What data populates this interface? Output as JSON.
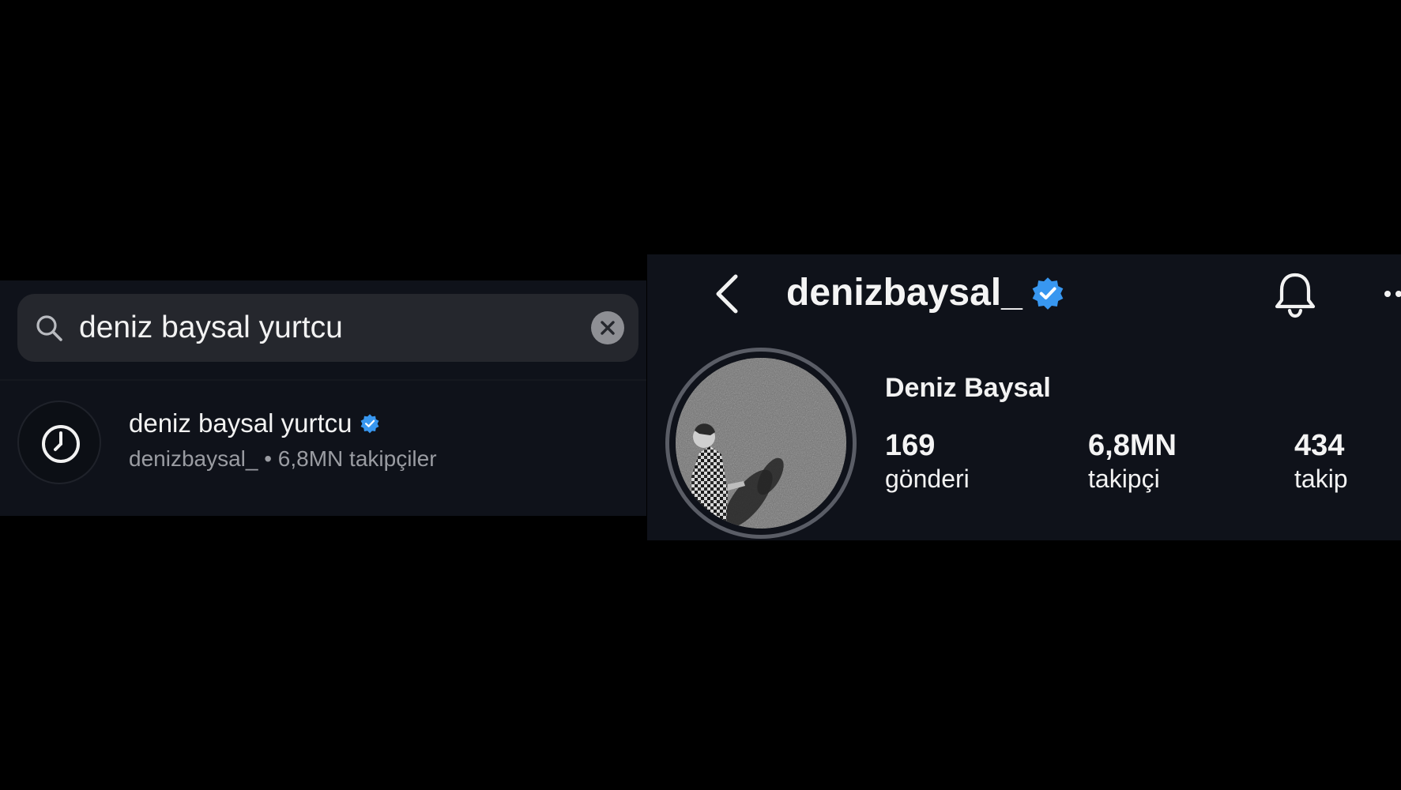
{
  "search_screen": {
    "search_query": "deniz baysal yurtcu",
    "recent_result": {
      "name": "deniz baysal yurtcu",
      "subtitle": "denizbaysal_ • 6,8MN takipçiler"
    }
  },
  "profile_screen": {
    "username": "denizbaysal_",
    "display_name": "Deniz Baysal",
    "stats": {
      "posts_value": "169",
      "posts_label": "gönderi",
      "followers_value": "6,8MN",
      "followers_label": "takipçi",
      "following_value": "434",
      "following_label": "takip"
    }
  },
  "icons": {
    "search": "search-icon",
    "clear": "clear-icon",
    "history": "clock-icon",
    "verified": "verified-badge-icon",
    "back": "chevron-left-icon",
    "notifications": "bell-icon",
    "more": "more-dots-icon"
  },
  "colors": {
    "background": "#000000",
    "panel": "#0f121a",
    "search_field": "#25272d",
    "verified_blue": "#3897f0",
    "secondary_text": "#9a9ca2"
  }
}
